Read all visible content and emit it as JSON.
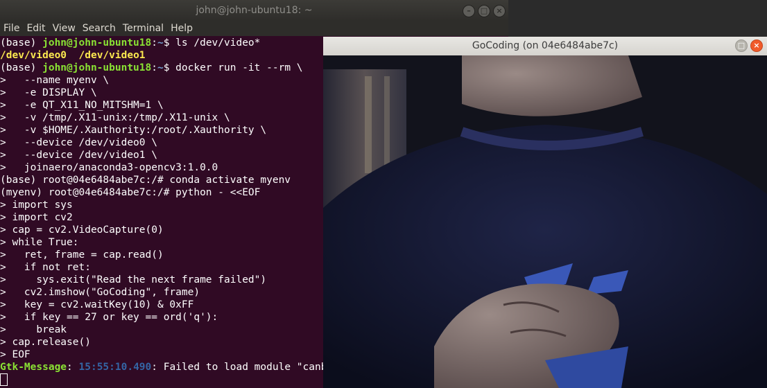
{
  "terminal": {
    "title": "john@john-ubuntu18: ~",
    "menu": [
      "File",
      "Edit",
      "View",
      "Search",
      "Terminal",
      "Help"
    ],
    "lines": [
      [
        {
          "t": "(base) "
        },
        {
          "t": "john@john-ubuntu18",
          "c": "g"
        },
        {
          "t": ":"
        },
        {
          "t": "~",
          "c": "b"
        },
        {
          "t": "$ ls /dev/video*"
        }
      ],
      [
        {
          "t": "/dev/video0",
          "c": "y"
        },
        {
          "t": "  "
        },
        {
          "t": "/dev/video1",
          "c": "y"
        }
      ],
      [
        {
          "t": "(base) "
        },
        {
          "t": "john@john-ubuntu18",
          "c": "g"
        },
        {
          "t": ":"
        },
        {
          "t": "~",
          "c": "b"
        },
        {
          "t": "$ docker run -it --rm \\"
        }
      ],
      [
        {
          "t": ">   --name myenv \\"
        }
      ],
      [
        {
          "t": ">   -e DISPLAY \\"
        }
      ],
      [
        {
          "t": ">   -e QT_X11_NO_MITSHM=1 \\"
        }
      ],
      [
        {
          "t": ">   -v /tmp/.X11-unix:/tmp/.X11-unix \\"
        }
      ],
      [
        {
          "t": ">   -v $HOME/.Xauthority:/root/.Xauthority \\"
        }
      ],
      [
        {
          "t": ">   --device /dev/video0 \\"
        }
      ],
      [
        {
          "t": ">   --device /dev/video1 \\"
        }
      ],
      [
        {
          "t": ">   joinaero/anaconda3-opencv3:1.0.0"
        }
      ],
      [
        {
          "t": "(base) root@04e6484abe7c:/# conda activate myenv"
        }
      ],
      [
        {
          "t": "(myenv) root@04e6484abe7c:/# python - <<EOF"
        }
      ],
      [
        {
          "t": "> import sys"
        }
      ],
      [
        {
          "t": "> import cv2"
        }
      ],
      [
        {
          "t": "> cap = cv2.VideoCapture(0)"
        }
      ],
      [
        {
          "t": "> while True:"
        }
      ],
      [
        {
          "t": ">   ret, frame = cap.read()"
        }
      ],
      [
        {
          "t": ">   if not ret:"
        }
      ],
      [
        {
          "t": ">     sys.exit(\"Read the next frame failed\")"
        }
      ],
      [
        {
          "t": ">   cv2.imshow(\"GoCoding\", frame)"
        }
      ],
      [
        {
          "t": ">   key = cv2.waitKey(10) & 0xFF"
        }
      ],
      [
        {
          "t": ">   if key == 27 or key == ord('q'):"
        }
      ],
      [
        {
          "t": ">     break"
        }
      ],
      [
        {
          "t": "> cap.release()"
        }
      ],
      [
        {
          "t": "> EOF"
        }
      ],
      [
        {
          "t": "Gtk-Message",
          "c": "g"
        },
        {
          "t": ": "
        },
        {
          "t": "15:55:10.490",
          "c": "bl"
        },
        {
          "t": ": Failed to load module \"canberra-gtk-module\""
        }
      ]
    ]
  },
  "camera_window": {
    "title": "GoCoding (on 04e6484abe7c)"
  },
  "colors": {
    "terminal_bg": "#300a24",
    "prompt_green": "#8ae234",
    "path_blue": "#729fcf",
    "device_yellow": "#fce94f",
    "close_orange": "#f05a2a"
  }
}
